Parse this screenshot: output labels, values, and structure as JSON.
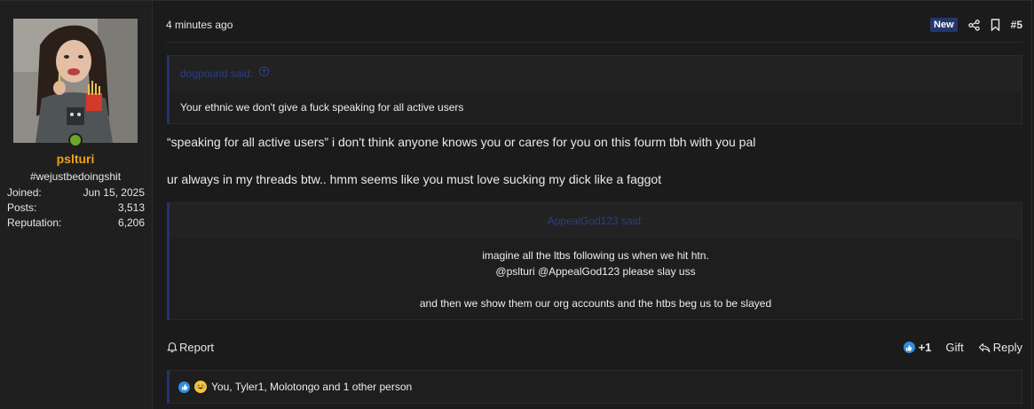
{
  "user": {
    "username": "pslturi",
    "user_title": "#wejustbedoingshit",
    "online_status_color": "#6aa82a",
    "username_color": "#f2a01a",
    "stats": [
      {
        "label": "Joined:",
        "value": "Jun 15, 2025"
      },
      {
        "label": "Posts:",
        "value": "3,513"
      },
      {
        "label": "Reputation:",
        "value": "6,206"
      }
    ]
  },
  "post": {
    "timestamp": "4 minutes ago",
    "new_badge": "New",
    "post_number": "#5",
    "quote1": {
      "author": "dogpound said:",
      "body": "Your ethnic we don't give a fuck speaking for all active users"
    },
    "lines": [
      "“speaking for all active users” i don't think anyone knows you or cares for you on this fourm tbh with you pal",
      "ur always in my threads btw.. hmm seems like you must love sucking my dick like a faggot"
    ],
    "quote2": {
      "author": "AppealGod123 said:",
      "line1": "imagine all the ltbs following us when we hit htn.",
      "line2": "@pslturi @AppealGod123 please slay uss",
      "line3": "and then we show them our org accounts and the htbs beg us to be slayed"
    }
  },
  "footer": {
    "report_label": "Report",
    "plus_one_label": "+1",
    "gift_label": "Gift",
    "reply_label": "Reply"
  },
  "reactions": {
    "text": "You, Tyler1, Molotongo and 1 other person",
    "icons": [
      "like-icon",
      "laugh-icon"
    ]
  },
  "colors": {
    "accent_blue": "#25336e",
    "quote_author": "#2c3f86",
    "background": "#1b1b1b"
  }
}
